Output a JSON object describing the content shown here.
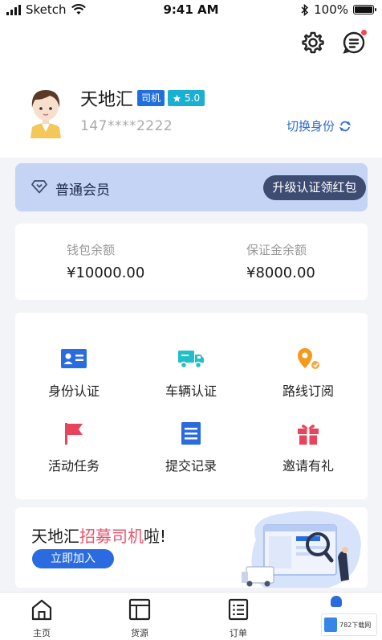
{
  "status_bar": {
    "carrier": "Sketch",
    "time": "9:41 AM",
    "battery": "100%",
    "icons": [
      "signal-icon",
      "wifi-icon",
      "bluetooth-icon",
      "battery-icon"
    ]
  },
  "header": {
    "icons": [
      "gear-icon",
      "message-icon"
    ],
    "message_badge_color": "#f24a4a"
  },
  "profile": {
    "name": "天地汇",
    "role_tag": "司机",
    "rating": "5.0",
    "phone": "147****2222",
    "switch_label": "切换身份"
  },
  "member": {
    "level": "普通会员",
    "upgrade_label": "升级认证领红包"
  },
  "balances": [
    {
      "title": "钱包余额",
      "value": "¥10000.00"
    },
    {
      "title": "保证金余额",
      "value": "¥8000.00"
    }
  ],
  "features": [
    {
      "label": "身份认证",
      "icon": "id-card-icon"
    },
    {
      "label": "车辆认证",
      "icon": "truck-icon"
    },
    {
      "label": "路线订阅",
      "icon": "route-icon"
    },
    {
      "label": "活动任务",
      "icon": "flag-icon"
    },
    {
      "label": "提交记录",
      "icon": "document-icon"
    },
    {
      "label": "邀请有礼",
      "icon": "gift-icon"
    }
  ],
  "recruit": {
    "prefix": "天地汇",
    "highlight": "招募司机",
    "suffix": "啦!",
    "button": "立即加入"
  },
  "tabs": [
    {
      "label": "主页",
      "icon": "home-icon"
    },
    {
      "label": "货源",
      "icon": "cargo-icon"
    },
    {
      "label": "订单",
      "icon": "orders-icon"
    }
  ],
  "watermark": "782下载网",
  "colors": {
    "accent": "#2b6be0",
    "member_banner": "#c5d3f5",
    "highlight": "#e9546b"
  }
}
